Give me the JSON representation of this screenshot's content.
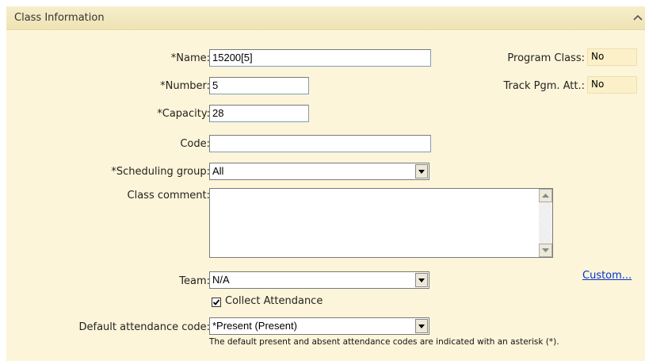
{
  "section": {
    "title": "Class Information"
  },
  "form": {
    "name_label": "*Name:",
    "name_value": "15200[5]",
    "number_label": "*Number:",
    "number_value": "5",
    "capacity_label": "*Capacity:",
    "capacity_value": "28",
    "code_label": "Code:",
    "code_value": "",
    "scheduling_group_label": "*Scheduling group:",
    "scheduling_group_value": "All",
    "class_comment_label": "Class comment:",
    "class_comment_value": "",
    "team_label": "Team:",
    "team_value": "N/A",
    "custom_link": "Custom...",
    "collect_attendance_label": "Collect Attendance",
    "collect_attendance_checked": true,
    "default_attendance_label": "Default attendance code:",
    "default_attendance_value": "*Present (Present)",
    "default_attendance_note": "The default present and absent attendance codes are indicated with an asterisk (*)."
  },
  "side": {
    "program_class_label": "Program Class:",
    "program_class_value": "No",
    "track_pgm_label": "Track Pgm. Att.:",
    "track_pgm_value": "No"
  },
  "icons": {
    "collapse": "chevron-up-icon",
    "dropdown": "triangle-down-icon",
    "scroll_up": "triangle-up-icon",
    "scroll_down": "triangle-down-icon",
    "check": "checkmark-icon"
  }
}
